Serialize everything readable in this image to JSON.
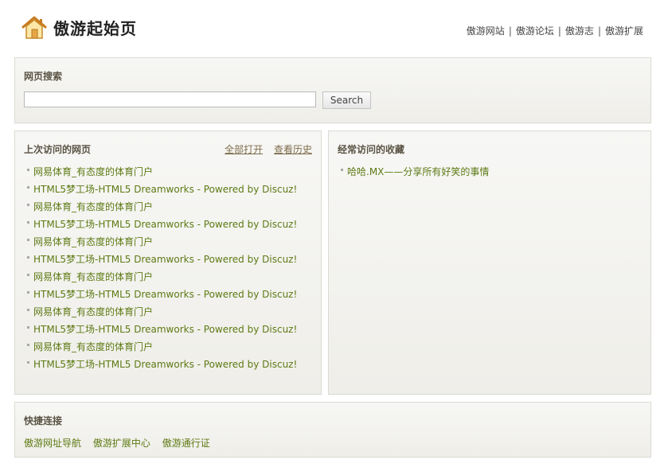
{
  "header": {
    "title": "傲游起始页",
    "links": [
      "傲游网站",
      "傲游论坛",
      "傲游志",
      "傲游扩展"
    ],
    "separator": "|"
  },
  "search": {
    "title": "网页搜索",
    "button_label": "Search",
    "value": "",
    "placeholder": ""
  },
  "recent": {
    "title": "上次访问的网页",
    "actions": [
      "全部打开",
      "查看历史"
    ],
    "items": [
      "网易体育_有态度的体育门户",
      "HTML5梦工场-HTML5 Dreamworks - Powered by Discuz!",
      "网易体育_有态度的体育门户",
      "HTML5梦工场-HTML5 Dreamworks - Powered by Discuz!",
      "网易体育_有态度的体育门户",
      "HTML5梦工场-HTML5 Dreamworks - Powered by Discuz!",
      "网易体育_有态度的体育门户",
      "HTML5梦工场-HTML5 Dreamworks - Powered by Discuz!",
      "网易体育_有态度的体育门户",
      "HTML5梦工场-HTML5 Dreamworks - Powered by Discuz!",
      "网易体育_有态度的体育门户",
      "HTML5梦工场-HTML5 Dreamworks - Powered by Discuz!"
    ]
  },
  "favorites": {
    "title": "经常访问的收藏",
    "items": [
      "哈哈.MX——分享所有好笑的事情"
    ]
  },
  "quick": {
    "title": "快捷连接",
    "links": [
      "傲游网址导航",
      "傲游扩展中心",
      "傲游通行证"
    ]
  },
  "colors": {
    "link": "#5d7a13",
    "panel_title": "#5a5344",
    "panel_border": "#dcdad3"
  },
  "icons": {
    "logo": "home-icon",
    "bullet": "bullet-icon"
  }
}
